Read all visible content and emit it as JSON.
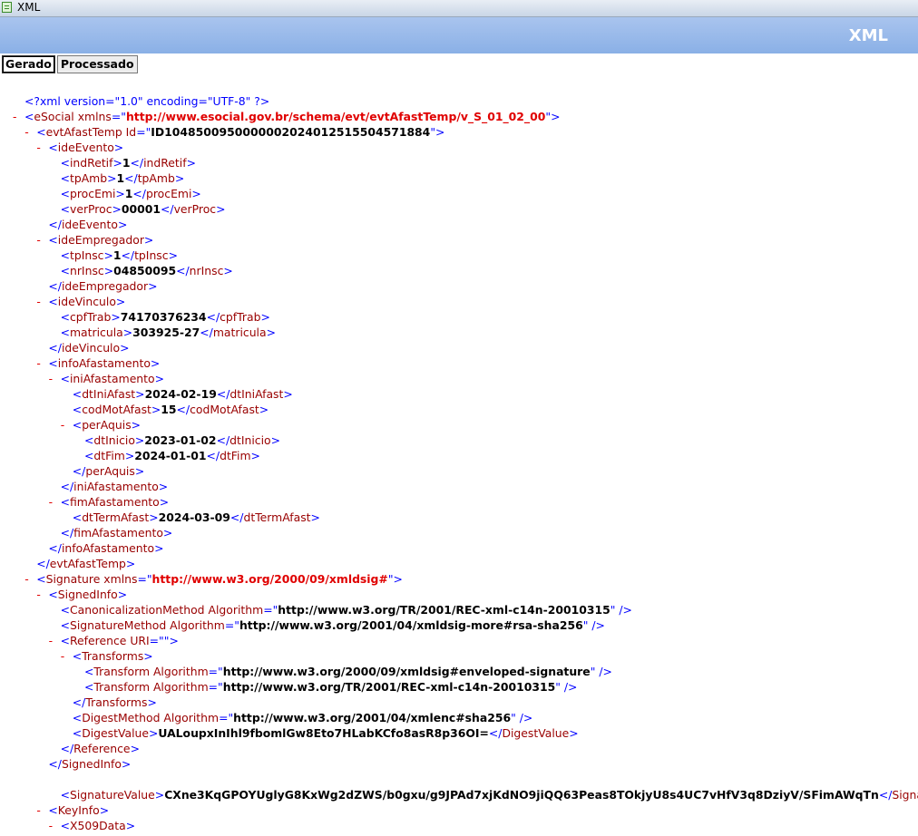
{
  "window": {
    "title": "XML"
  },
  "header": {
    "title": "XML"
  },
  "tabs": [
    {
      "label": "Gerado",
      "active": true
    },
    {
      "label": "Processado",
      "active": false
    }
  ],
  "colors": {
    "header_bg": "#8ab0e6",
    "tag": "#990000",
    "bracket": "#0000ff",
    "namespace": "#e00000",
    "toggle": "#e00000"
  },
  "xml": {
    "declaration": "<?xml version=\"1.0\" encoding=\"UTF-8\" ?>",
    "lines": [
      {
        "indent": 0,
        "toggle": true,
        "kind": "open",
        "tag": "eSocial",
        "attr": "xmlns",
        "value": "http://www.esocial.gov.br/schema/evt/evtAfastTemp/v_S_01_02_00",
        "ns": true
      },
      {
        "indent": 1,
        "toggle": true,
        "kind": "open",
        "tag": "evtAfastTemp",
        "attr": "Id",
        "value": "ID1048500950000002024012515504571884"
      },
      {
        "indent": 2,
        "toggle": true,
        "kind": "open",
        "tag": "ideEvento"
      },
      {
        "indent": 3,
        "kind": "leaf",
        "tag": "indRetif",
        "value": "1"
      },
      {
        "indent": 3,
        "kind": "leaf",
        "tag": "tpAmb",
        "value": "1"
      },
      {
        "indent": 3,
        "kind": "leaf",
        "tag": "procEmi",
        "value": "1"
      },
      {
        "indent": 3,
        "kind": "leaf",
        "tag": "verProc",
        "value": "00001"
      },
      {
        "indent": 2,
        "kind": "close",
        "tag": "ideEvento"
      },
      {
        "indent": 2,
        "toggle": true,
        "kind": "open",
        "tag": "ideEmpregador"
      },
      {
        "indent": 3,
        "kind": "leaf",
        "tag": "tpInsc",
        "value": "1"
      },
      {
        "indent": 3,
        "kind": "leaf",
        "tag": "nrInsc",
        "value": "04850095"
      },
      {
        "indent": 2,
        "kind": "close",
        "tag": "ideEmpregador"
      },
      {
        "indent": 2,
        "toggle": true,
        "kind": "open",
        "tag": "ideVinculo"
      },
      {
        "indent": 3,
        "kind": "leaf",
        "tag": "cpfTrab",
        "value": "74170376234"
      },
      {
        "indent": 3,
        "kind": "leaf",
        "tag": "matricula",
        "value": "303925-27"
      },
      {
        "indent": 2,
        "kind": "close",
        "tag": "ideVinculo"
      },
      {
        "indent": 2,
        "toggle": true,
        "kind": "open",
        "tag": "infoAfastamento"
      },
      {
        "indent": 3,
        "toggle": true,
        "kind": "open",
        "tag": "iniAfastamento"
      },
      {
        "indent": 4,
        "kind": "leaf",
        "tag": "dtIniAfast",
        "value": "2024-02-19"
      },
      {
        "indent": 4,
        "kind": "leaf",
        "tag": "codMotAfast",
        "value": "15"
      },
      {
        "indent": 4,
        "toggle": true,
        "kind": "open",
        "tag": "perAquis"
      },
      {
        "indent": 5,
        "kind": "leaf",
        "tag": "dtInicio",
        "value": "2023-01-02"
      },
      {
        "indent": 5,
        "kind": "leaf",
        "tag": "dtFim",
        "value": "2024-01-01"
      },
      {
        "indent": 4,
        "kind": "close",
        "tag": "perAquis"
      },
      {
        "indent": 3,
        "kind": "close",
        "tag": "iniAfastamento"
      },
      {
        "indent": 3,
        "toggle": true,
        "kind": "open",
        "tag": "fimAfastamento"
      },
      {
        "indent": 4,
        "kind": "leaf",
        "tag": "dtTermAfast",
        "value": "2024-03-09"
      },
      {
        "indent": 3,
        "kind": "close",
        "tag": "fimAfastamento"
      },
      {
        "indent": 2,
        "kind": "close",
        "tag": "infoAfastamento"
      },
      {
        "indent": 1,
        "kind": "close",
        "tag": "evtAfastTemp"
      },
      {
        "indent": 1,
        "toggle": true,
        "kind": "open",
        "tag": "Signature",
        "attr": "xmlns",
        "value": "http://www.w3.org/2000/09/xmldsig#",
        "ns": true
      },
      {
        "indent": 2,
        "toggle": true,
        "kind": "open",
        "tag": "SignedInfo"
      },
      {
        "indent": 3,
        "kind": "empty",
        "tag": "CanonicalizationMethod",
        "attr": "Algorithm",
        "value": "http://www.w3.org/TR/2001/REC-xml-c14n-20010315"
      },
      {
        "indent": 3,
        "kind": "empty",
        "tag": "SignatureMethod",
        "attr": "Algorithm",
        "value": "http://www.w3.org/2001/04/xmldsig-more#rsa-sha256"
      },
      {
        "indent": 3,
        "toggle": true,
        "kind": "open",
        "tag": "Reference",
        "attr": "URI",
        "value": ""
      },
      {
        "indent": 4,
        "toggle": true,
        "kind": "open",
        "tag": "Transforms"
      },
      {
        "indent": 5,
        "kind": "empty",
        "tag": "Transform",
        "attr": "Algorithm",
        "value": "http://www.w3.org/2000/09/xmldsig#enveloped-signature"
      },
      {
        "indent": 5,
        "kind": "empty",
        "tag": "Transform",
        "attr": "Algorithm",
        "value": "http://www.w3.org/TR/2001/REC-xml-c14n-20010315"
      },
      {
        "indent": 4,
        "kind": "close",
        "tag": "Transforms"
      },
      {
        "indent": 4,
        "kind": "empty",
        "tag": "DigestMethod",
        "attr": "Algorithm",
        "value": "http://www.w3.org/2001/04/xmlenc#sha256"
      },
      {
        "indent": 4,
        "kind": "leaf",
        "tag": "DigestValue",
        "value": "UALoupxInIhl9fbomlGw8Eto7HLabKCfo8asR8p36OI="
      },
      {
        "indent": 3,
        "kind": "close",
        "tag": "Reference"
      },
      {
        "indent": 2,
        "kind": "close",
        "tag": "SignedInfo"
      },
      {
        "indent": 3,
        "kind": "leaf",
        "tag": "SignatureValue",
        "value": "CXne3KqGPOYUglyG8KxWg2dZWS/b0gxu/g9JPAd7xjKdNO9jiQQ63Peas8TOkjyU8s4UC7vHfV3q8DziyV/SFimAWqTn",
        "gap": true
      },
      {
        "indent": 2,
        "toggle": true,
        "kind": "open",
        "tag": "KeyInfo"
      },
      {
        "indent": 3,
        "toggle": true,
        "kind": "open",
        "tag": "X509Data"
      }
    ]
  }
}
